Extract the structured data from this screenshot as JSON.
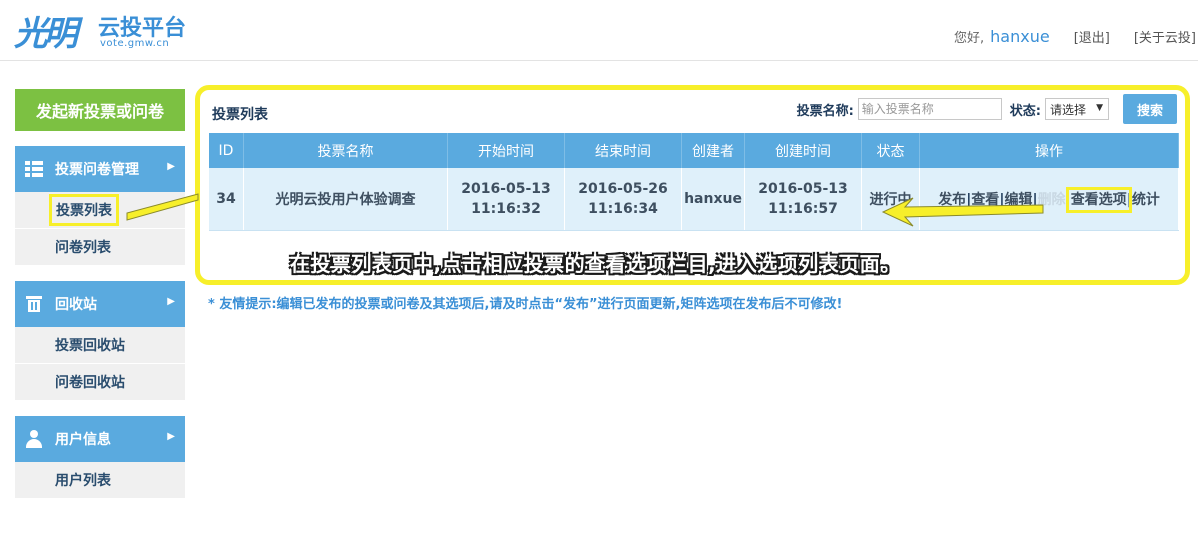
{
  "header": {
    "logo_script": "光明",
    "logo_name": "云投平台",
    "logo_sub": "vote.gmw.cn",
    "greeting": "您好,",
    "username": "hanxue",
    "logout": "[退出]",
    "about": "[关于云投]"
  },
  "sidebar": {
    "primary_button": "发起新投票或问卷",
    "groups": [
      {
        "title": "投票问卷管理",
        "icon": "list-icon",
        "items": [
          "投票列表",
          "问卷列表"
        ]
      },
      {
        "title": "回收站",
        "icon": "trash-icon",
        "items": [
          "投票回收站",
          "问卷回收站"
        ]
      },
      {
        "title": "用户信息",
        "icon": "user-icon",
        "items": [
          "用户列表"
        ]
      }
    ],
    "active_item": "投票列表"
  },
  "main": {
    "panel_title": "投票列表",
    "search": {
      "name_label": "投票名称:",
      "name_placeholder": "输入投票名称",
      "status_label": "状态:",
      "status_value": "请选择",
      "button": "搜索"
    },
    "table": {
      "headers": [
        "ID",
        "投票名称",
        "开始时间",
        "结束时间",
        "创建者",
        "创建时间",
        "状态",
        "操作"
      ],
      "rows": [
        {
          "id": "34",
          "name": "光明云投用户体验调查",
          "start_date": "2016-05-13",
          "start_time": "11:16:32",
          "end_date": "2016-05-26",
          "end_time": "11:16:34",
          "creator": "hanxue",
          "created_date": "2016-05-13",
          "created_time": "11:16:57",
          "status": "进行中",
          "ops": [
            "发布",
            "查看",
            "编辑",
            "删除",
            "查看选项",
            "统计"
          ]
        }
      ]
    },
    "annotation": "在投票列表页中,点击相应投票的查看选项栏目,进入选项列表页面。",
    "tip": "* 友情提示:编辑已发布的投票或问卷及其选项后,请及时点击“发布”进行页面更新,矩阵选项在发布后不可修改!"
  },
  "colors": {
    "accent_blue": "#5aaadf",
    "green_button": "#7cc142",
    "highlight_yellow": "#f7ef2a"
  }
}
